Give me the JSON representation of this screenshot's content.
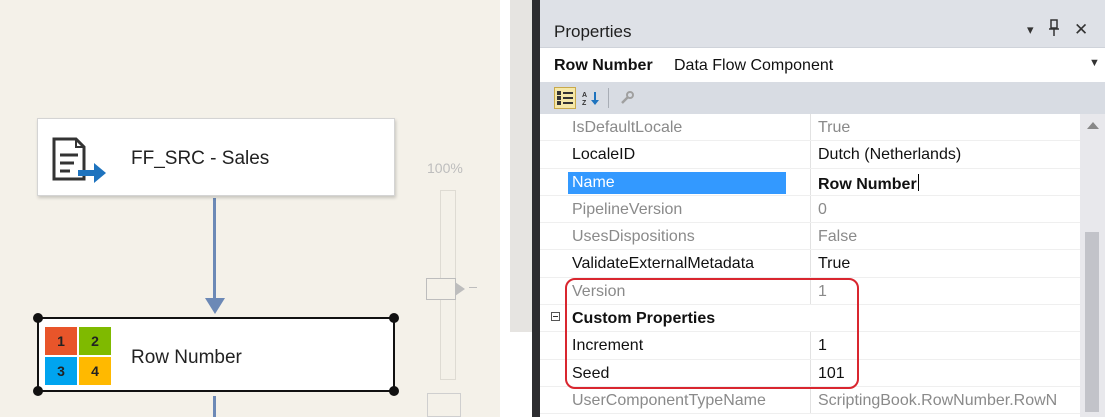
{
  "designer": {
    "nodes": [
      {
        "label": "FF_SRC - Sales",
        "icon": "flat-file-source-icon"
      },
      {
        "label": "Row Number",
        "icon": "row-number-icon"
      }
    ],
    "row_number_icon_cells": [
      {
        "text": "1",
        "color": "#e8552a"
      },
      {
        "text": "2",
        "color": "#7fba00"
      },
      {
        "text": "3",
        "color": "#00a4ef"
      },
      {
        "text": "4",
        "color": "#ffb900"
      }
    ],
    "zoom": "100%"
  },
  "properties": {
    "title": "Properties",
    "header_buttons": {
      "dropdown": "▾",
      "pin": "📌",
      "close": "✕"
    },
    "object_name": "Row Number",
    "object_type": "Data Flow Component",
    "rows": [
      {
        "name": "IsDefaultLocale",
        "value": "True",
        "style": "grey"
      },
      {
        "name": "LocaleID",
        "value": "Dutch (Netherlands)",
        "style": "normal"
      },
      {
        "name": "Name",
        "value": "Row Number",
        "style": "selected"
      },
      {
        "name": "PipelineVersion",
        "value": "0",
        "style": "grey"
      },
      {
        "name": "UsesDispositions",
        "value": "False",
        "style": "grey"
      },
      {
        "name": "ValidateExternalMetadata",
        "value": "True",
        "style": "normal"
      },
      {
        "name": "Version",
        "value": "1",
        "style": "grey"
      },
      {
        "name": "Custom Properties",
        "value": "",
        "style": "category"
      },
      {
        "name": "Increment",
        "value": "1",
        "style": "normal"
      },
      {
        "name": "Seed",
        "value": "101",
        "style": "normal"
      },
      {
        "name": "UserComponentTypeName",
        "value": "ScriptingBook.RowNumber.RowN",
        "style": "grey"
      }
    ]
  },
  "colors": {
    "highlight": "#d9262f",
    "selection": "#3399ff",
    "connector": "#6c89b6"
  }
}
